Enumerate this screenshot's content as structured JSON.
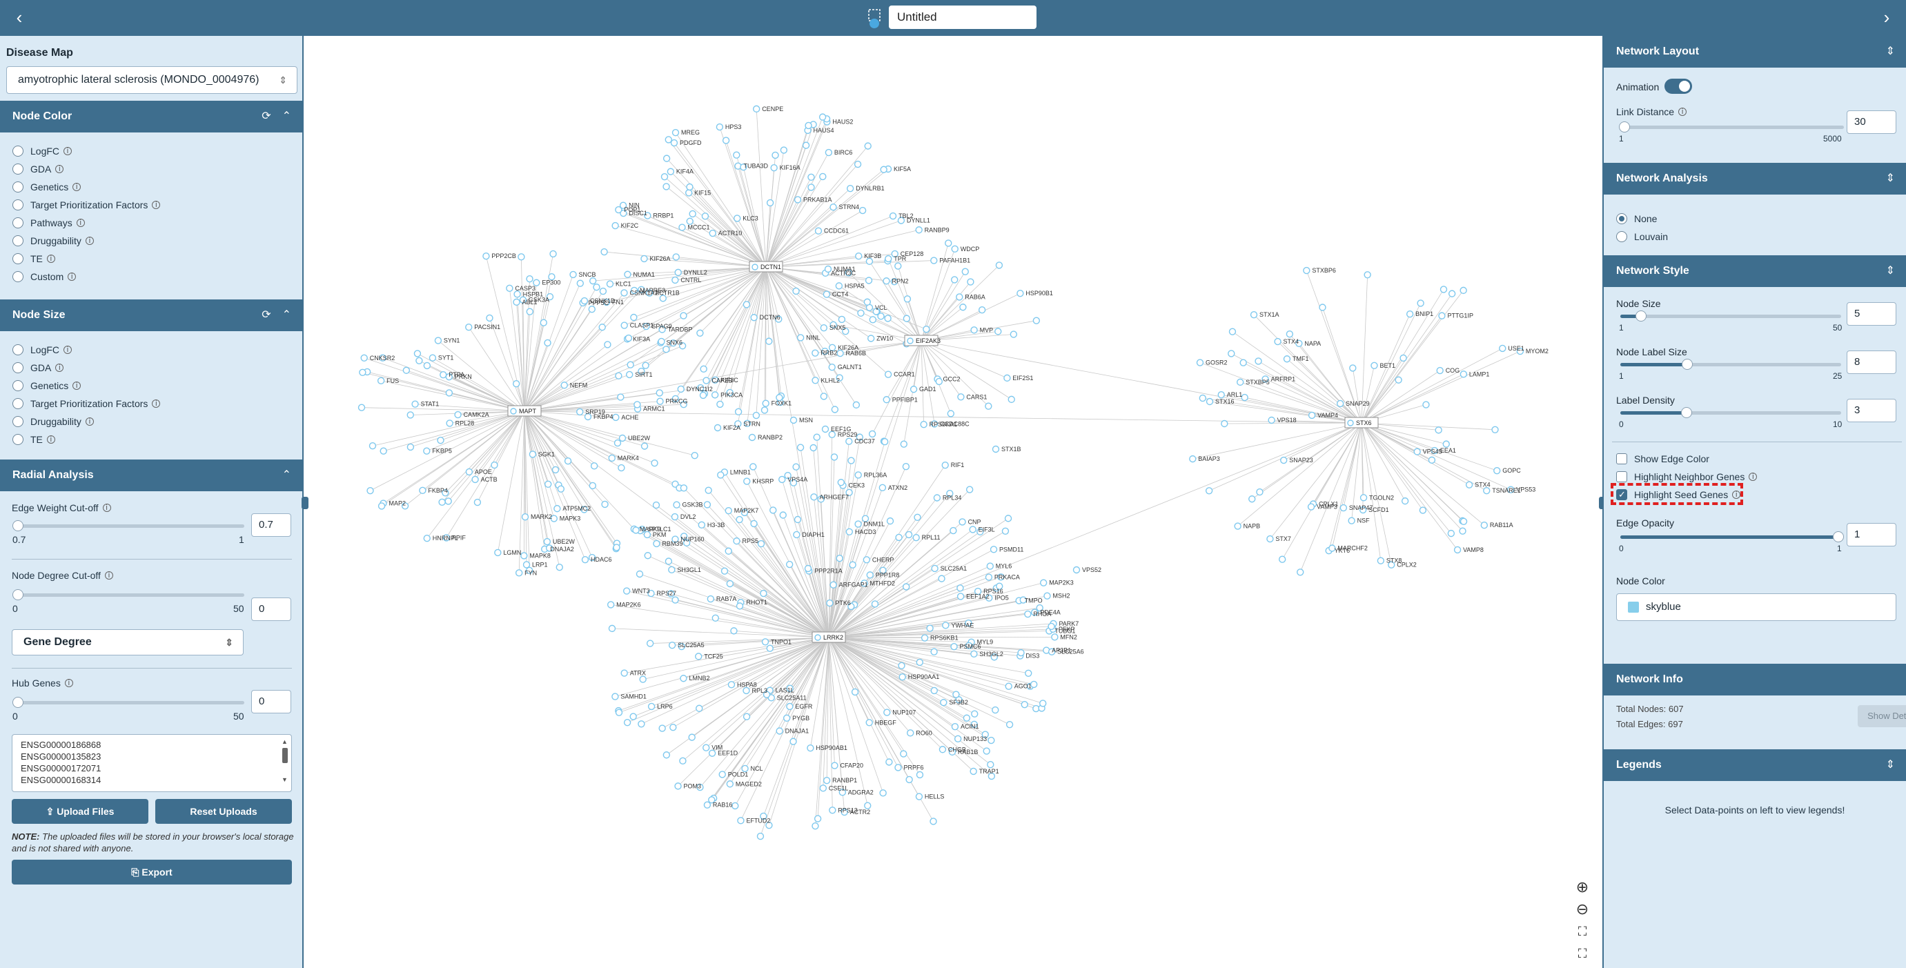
{
  "topbar": {
    "title_value": "Untitled",
    "back_icon": "‹",
    "forward_icon": "›"
  },
  "left": {
    "disease_map": {
      "label": "Disease Map",
      "selected": "amyotrophic lateral sclerosis (MONDO_0004976)"
    },
    "node_color": {
      "header": "Node Color",
      "options": [
        "LogFC",
        "GDA",
        "Genetics",
        "Target Prioritization Factors",
        "Pathways",
        "Druggability",
        "TE",
        "Custom"
      ]
    },
    "node_size": {
      "header": "Node Size",
      "options": [
        "LogFC",
        "GDA",
        "Genetics",
        "Target Prioritization Factors",
        "Druggability",
        "TE"
      ]
    },
    "radial": {
      "header": "Radial Analysis",
      "edge_weight": {
        "label": "Edge Weight Cut-off",
        "min": "0.7",
        "max": "1",
        "value": "0.7"
      },
      "node_degree": {
        "label": "Node Degree Cut-off",
        "min": "0",
        "max": "50",
        "value": "0"
      },
      "degree_select": "Gene Degree",
      "hub_genes": {
        "label": "Hub Genes",
        "min": "0",
        "max": "50",
        "value": "0"
      },
      "genes_list": [
        "ENSG00000186868",
        "ENSG00000135823",
        "ENSG00000172071",
        "ENSG00000168314"
      ],
      "upload_label": "Upload Files",
      "reset_label": "Reset Uploads",
      "note_prefix": "NOTE:",
      "note_text": " The uploaded files will be stored in your browser's local storage and is not shared with anyone.",
      "export_label": "Export"
    }
  },
  "right": {
    "layout": {
      "header": "Network Layout",
      "animation_label": "Animation",
      "link_distance": {
        "label": "Link Distance",
        "min": "1",
        "max": "5000",
        "value": "30"
      }
    },
    "analysis": {
      "header": "Network Analysis",
      "options": [
        "None",
        "Louvain"
      ]
    },
    "style": {
      "header": "Network Style",
      "node_size": {
        "label": "Node Size",
        "min": "1",
        "max": "50",
        "value": "5"
      },
      "label_size": {
        "label": "Node Label Size",
        "min": "1",
        "max": "25",
        "value": "8"
      },
      "label_density": {
        "label": "Label Density",
        "min": "0",
        "max": "10",
        "value": "3"
      },
      "checks": [
        "Show Edge Color",
        "Highlight Neighbor Genes",
        "Highlight Seed Genes"
      ],
      "edge_opacity": {
        "label": "Edge Opacity",
        "min": "0",
        "max": "1",
        "value": "1"
      },
      "node_color_label": "Node Color",
      "node_color_value": "skyblue"
    },
    "info": {
      "header": "Network Info",
      "total_nodes": "Total Nodes: 607",
      "total_edges": "Total Edges: 697",
      "details_label": "Show Details"
    },
    "legends": {
      "header": "Legends",
      "empty_text": "Select Data-points on left to view legends!"
    }
  },
  "graph": {
    "node_color": "#bfe4f7",
    "hubs": [
      {
        "id": "DCTN1",
        "label": "DCTN1",
        "labels": [
          "KIF5A",
          "RANBP9",
          "DISC1",
          "ACTR10",
          "HPS3",
          "TUBA3D",
          "CENPE",
          "PAFAH1B1",
          "NINL",
          "PDGFD",
          "GALNT1",
          "KIF3C",
          "KLC3",
          "KIF2C",
          "CLASP1",
          "CCAR1",
          "CNTRL",
          "STRN4",
          "DYNC1I2",
          "DCTN6",
          "KIF3B",
          "MREG",
          "PIK3CA",
          "CCT4",
          "KIF3A",
          "DYNLRB1",
          "DYNLL2",
          "DYNLL1",
          "CAPZB",
          "POP1",
          "NIN",
          "CEP128",
          "KIF15",
          "KIF4A",
          "KLHL2",
          "ACTR3C",
          "ACTR1B",
          "STRN",
          "VCL",
          "SNX6",
          "MCCC1",
          "ZW10",
          "KIF16A",
          "SPAG9",
          "FN1",
          "CCDC61",
          "KIF26A",
          "KLC1",
          "SNX5",
          "KIF22",
          "NUMA1",
          "HAUS2",
          "RRBP1",
          "BIRC6",
          "FOXK1",
          "TBL2",
          "PRKAB1A",
          "HAUS4",
          "KIF26A"
        ]
      },
      {
        "id": "EIF2AK3",
        "label": "EIF2AK3",
        "labels": [
          "HSP90B1",
          "RPS6KA1",
          "RRB2",
          "CARS1",
          "PPFIBP1",
          "RPN2",
          "GAD1",
          "EIF2S1",
          "MVP",
          "HSPA5",
          "WDCP",
          "TPR",
          "RAB6B",
          "RAB6A",
          "GCC2",
          "CCDC88C"
        ]
      },
      {
        "id": "MAPT",
        "label": "MAPT",
        "labels": [
          "SIRT1",
          "LRP1",
          "SYT1",
          "PTPA",
          "EP300",
          "RPL28",
          "HDAC6",
          "PPP2CB",
          "NEFM",
          "MAPK9",
          "FKBP5",
          "MAPK3",
          "ABL1",
          "FYN",
          "CASP3",
          "PPIF",
          "STAT1",
          "SNCB",
          "MARK2",
          "FUS",
          "GSK3A",
          "PPP5C",
          "PACSIN1",
          "TARDBP",
          "FKBP4",
          "UBE2W",
          "SYN1",
          "LGMN",
          "CNKSR2",
          "ATP5MC2",
          "CSNK1D",
          "PRKCG",
          "SRP19",
          "APOE",
          "CSNK1A1",
          "HNRNPL",
          "SGK1",
          "CAMK2A",
          "PRKN",
          "HSPB1",
          "DNAJA2",
          "ACHE",
          "MAPK8",
          "MAP2",
          "ARMC1",
          "MARK4",
          "ACTB",
          "MAPRE3"
        ]
      },
      {
        "id": "STX6",
        "label": "STX6",
        "labels": [
          "TGOLN2",
          "NAPA",
          "STX7",
          "VPS18",
          "ARFRP1",
          "TSNARE1",
          "STX4",
          "NSF",
          "STXBP6",
          "CPLX1",
          "GOPC",
          "VAMP4",
          "GOSR2",
          "YKT6",
          "COG",
          "RAB11A",
          "MARCHF2",
          "VAMP8",
          "VAMP3",
          "NAPB",
          "TMF1",
          "ARL1",
          "USE1",
          "STX1A",
          "EEA1",
          "CPLX2",
          "STX16",
          "SCFD1",
          "SNAP29",
          "STX4",
          "SNAP23",
          "BAIAP3",
          "SNAP47",
          "LAMP1",
          "VPS53",
          "BNIP1",
          "VPS45",
          "BET1",
          "STXBP5",
          "STX8",
          "MYOM2",
          "PTTG1IP"
        ]
      },
      {
        "id": "LRRK2",
        "label": "LRRK2",
        "labels": [
          "GSK3B",
          "EEF1A2",
          "HSP90AB1",
          "YWHAE",
          "HSP90AA1",
          "MFN2",
          "RPS6KB1",
          "DNAJA1",
          "PRKACA",
          "AP3B1",
          "TUBG1",
          "HSPA8",
          "RAB16",
          "LRP6",
          "DNM1L",
          "NCL",
          "RHOA",
          "SLC25A11",
          "EFTUD2",
          "IPO5",
          "TNPO1",
          "H3-3B",
          "DIAPH1",
          "SLC25A5",
          "RBM39",
          "RAB7A",
          "VPS4A",
          "WNT3",
          "RIF1",
          "ATRX",
          "CHERP",
          "EIF3L",
          "NUP133",
          "RPS29",
          "AGO1",
          "MSH2",
          "KHSRP",
          "RPS5",
          "EEF1D",
          "MYL6",
          "PFKP",
          "MAP2K7",
          "MTHFD2",
          "SAMHD1",
          "RO60",
          "ARHGEF7",
          "POLD1",
          "HBEGF",
          "MAP2K3",
          "PSMC6",
          "ACIN1",
          "PPP1R8",
          "HACD3",
          "ADGRA2",
          "PPP2R1A",
          "PDE4A",
          "PSMD11",
          "SLC25A1",
          "RPS16",
          "TCF25",
          "PTK6",
          "SH3GL2",
          "RPS13",
          "NUP160",
          "MAP2K6",
          "RHOT1",
          "CEK3",
          "ATXN2",
          "ARFGAP1",
          "PKM",
          "PRPF6",
          "HELLS",
          "RPL3",
          "PARK7",
          "CHGB",
          "RPS27",
          "SH3GL1",
          "TMPO",
          "MAGED2",
          "RANBP1",
          "DIS3",
          "RAB1B",
          "POM3",
          "DVL2",
          "ACTR2",
          "CSE1L",
          "SF3B2",
          "MYL9",
          "CFAP20",
          "RPL36A",
          "CDC37",
          "LMNB1",
          "SLC25A6",
          "RPL34",
          "RPL11",
          "TRAP1",
          "SPTLC1",
          "NUP107",
          "LMNB2",
          "PYGB",
          "CNP",
          "EGFR",
          "VIM",
          "LAS1L"
        ]
      }
    ],
    "free_labels": [
      "STX1B",
      "VPS52",
      "NUMA1",
      "MSN",
      "EEF1G",
      "KIF2A",
      "RANBP2",
      "FKBP4",
      "UBE2W"
    ]
  }
}
